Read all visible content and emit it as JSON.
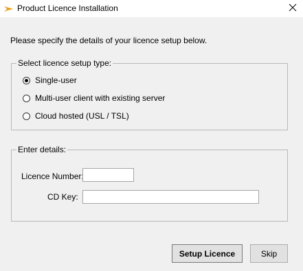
{
  "window": {
    "title": "Product Licence Installation",
    "icon": "orange-arrow-icon",
    "close_icon": "close-icon"
  },
  "intro_text": "Please specify the details of your licence setup below.",
  "setup_type": {
    "legend": "Select licence setup type:",
    "options": [
      {
        "label": "Single-user",
        "checked": true
      },
      {
        "label": "Multi-user client with existing server",
        "checked": false
      },
      {
        "label": "Cloud hosted (USL / TSL)",
        "checked": false
      }
    ]
  },
  "details": {
    "legend": "Enter details:",
    "licence_number_label": "Licence Number:",
    "licence_number_value": "",
    "cd_key_label": "CD Key:",
    "cd_key_value": ""
  },
  "buttons": {
    "setup_label": "Setup Licence",
    "skip_label": "Skip"
  },
  "colors": {
    "icon_accent": "#f5a623",
    "window_bg": "#f0f0f0",
    "titlebar_bg": "#ffffff"
  }
}
